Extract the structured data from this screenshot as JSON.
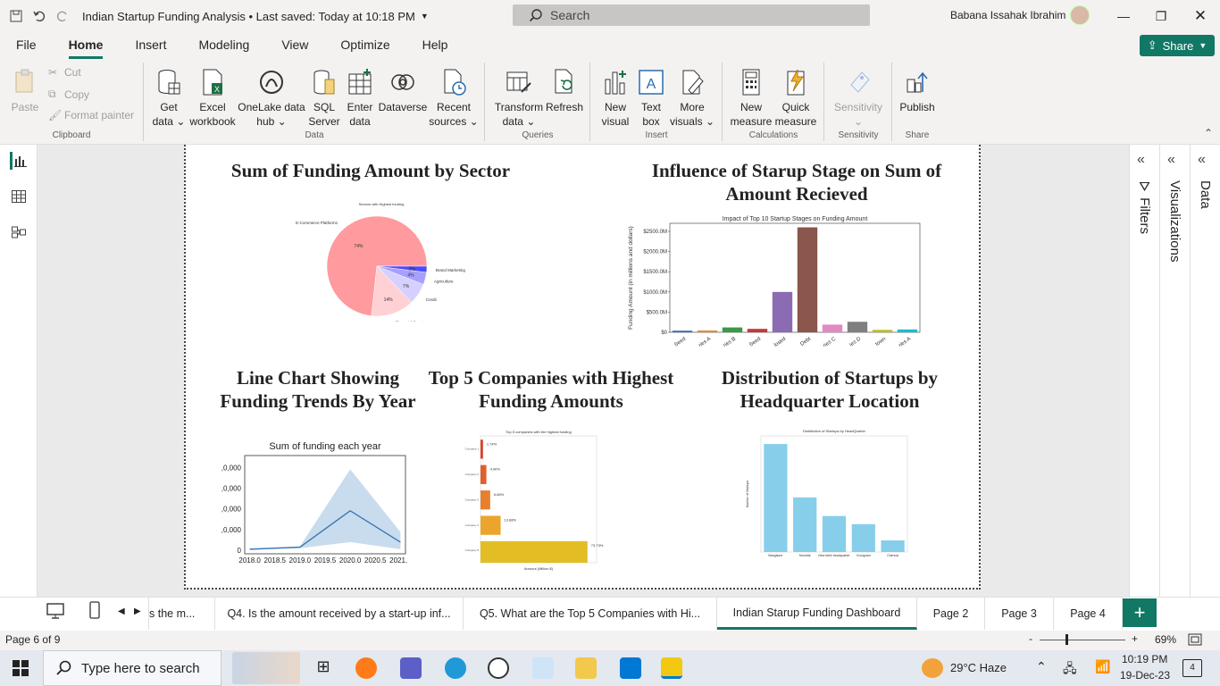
{
  "titlebar": {
    "title": "Indian Startup Funding Analysis • Last saved: Today at 10:18 PM",
    "search_placeholder": "Search",
    "user": "Babana Issahak Ibrahim"
  },
  "menu": [
    "File",
    "Home",
    "Insert",
    "Modeling",
    "View",
    "Optimize",
    "Help"
  ],
  "share_label": "Share",
  "ribbon": {
    "clipboard": {
      "paste": "Paste",
      "cut": "Cut",
      "copy": "Copy",
      "format_painter": "Format painter",
      "group": "Clipboard"
    },
    "data": {
      "get_data": [
        "Get",
        "data ⌄"
      ],
      "excel": [
        "Excel",
        "workbook"
      ],
      "onelake": [
        "OneLake data",
        "hub ⌄"
      ],
      "sql": [
        "SQL",
        "Server"
      ],
      "enter": [
        "Enter",
        "data"
      ],
      "dataverse": [
        "Dataverse",
        ""
      ],
      "recent": [
        "Recent",
        "sources ⌄"
      ],
      "group": "Data"
    },
    "queries": {
      "transform": [
        "Transform",
        "data ⌄"
      ],
      "refresh": [
        "Refresh",
        ""
      ],
      "group": "Queries"
    },
    "insert": {
      "new_visual": [
        "New",
        "visual"
      ],
      "text_box": [
        "Text",
        "box"
      ],
      "more_visuals": [
        "More",
        "visuals ⌄"
      ],
      "group": "Insert"
    },
    "calculations": {
      "new_measure": [
        "New",
        "measure"
      ],
      "quick_measure": [
        "Quick",
        "measure"
      ],
      "group": "Calculations"
    },
    "sensitivity": {
      "label": [
        "Sensitivity",
        "⌄"
      ],
      "group": "Sensitivity"
    },
    "share": {
      "publish": [
        "Publish",
        ""
      ],
      "group": "Share"
    }
  },
  "visuals": {
    "v1_title": "Sum of Funding Amount by Sector",
    "v2_title": "Influence of Starup Stage on Sum of Amount Recieved",
    "v3_title": "Line Chart Showing Funding Trends By Year",
    "v4_title": "Top 5 Companies with Highest Funding Amounts",
    "v5_title": "Distribution of Startups by Headquarter Location"
  },
  "chart_data": [
    {
      "type": "pie",
      "title": "Sectors with Highest funding",
      "categories": [
        "E-Commerce Platforms",
        "Financial Services",
        "Credit",
        "Agriculture",
        "Brand Marketing"
      ],
      "values": [
        74,
        14,
        7,
        4,
        2
      ],
      "labels": [
        "74%",
        "14%",
        "7%",
        "4%",
        "2%"
      ],
      "colors": [
        "#ff9a9e",
        "#ffd0d4",
        "#d6d0ff",
        "#a8a0ff",
        "#4a4aff"
      ]
    },
    {
      "type": "bar",
      "title": "Impact of Top 10 Startup Stages on Funding Amount",
      "ylabel": "Funding Amount (in millions and dollars)",
      "categories": [
        "Seed",
        "Series A",
        "Series B",
        "Seed",
        "Undisclosed",
        "Debt",
        "Series C",
        "Series D",
        "Unknown",
        "Pre-series A"
      ],
      "tick_labels": [
        "Seed",
        "ries A",
        "ries B",
        "Seed",
        "losed",
        "Debt",
        "ries C",
        "ies D",
        "town",
        "ries A"
      ],
      "values": [
        40,
        45,
        120,
        85,
        1000,
        2600,
        190,
        260,
        60,
        70
      ],
      "yticks": [
        "$0",
        "$500.0M",
        "$1000.0M",
        "$1500.0M",
        "$2000.0M",
        "$2500.0M"
      ],
      "ylim": [
        0,
        2700
      ],
      "colors": [
        "#3b6fb6",
        "#e08b3c",
        "#3a9a46",
        "#c33a3a",
        "#8c6bb5",
        "#8b564b",
        "#e08ac2",
        "#7f7f7f",
        "#bcbd22",
        "#17becf"
      ]
    },
    {
      "type": "line",
      "title": "Sum of funding each year",
      "x": [
        2018,
        2019,
        2020,
        2021
      ],
      "values": [
        0.5,
        1.5,
        19.5,
        4
      ],
      "ci_low": [
        0.5,
        1,
        4,
        0.5
      ],
      "ci_high": [
        0.5,
        2,
        40,
        9
      ],
      "xticks": [
        "2018.0",
        "2018.5",
        "2019.0",
        "2019.5",
        "2020.0",
        "2020.5",
        "2021.0"
      ],
      "yticks": [
        "0",
        ",0,000",
        ",0,000",
        ",0,000",
        ",0,000"
      ],
      "ylim": [
        0,
        45
      ]
    },
    {
      "type": "bar",
      "orientation": "horizontal",
      "title": "Top 5 companies with the highest funding",
      "xlabel": "Amount (Million $)",
      "categories": [
        "Company 1",
        "Company 2",
        "Company 3",
        "Company 4",
        "Company 5"
      ],
      "values": [
        1.74,
        4.06,
        6.68,
        13.88,
        73.73
      ],
      "labels": [
        "1.74%",
        "4.06%",
        "6.68%",
        "13.88%",
        "73.73%"
      ],
      "colors": [
        "#d9442a",
        "#e0602c",
        "#e6802e",
        "#eba52c",
        "#e3bd24"
      ]
    },
    {
      "type": "bar",
      "title": "Distribution of Startups by HeadQuarter",
      "ylabel": "Number of Startups",
      "categories": [
        "Bangalore",
        "Mumbai",
        "New Delhi Headquarter",
        "Gurugram",
        "Chennai"
      ],
      "tick_labels": [
        "Bangalore",
        "Mumbai",
        "New delhi headquarter",
        "Gurugram",
        "Chennai"
      ],
      "values": [
        930,
        470,
        310,
        240,
        100
      ],
      "ylim": [
        0,
        1000
      ],
      "color": "#87ceeb"
    }
  ],
  "pane_labels": {
    "filters": "Filters",
    "visualizations": "Visualizations",
    "data": "Data"
  },
  "tabs": [
    "s the m...",
    "Q4. Is the amount received by a start-up inf...",
    "Q5. What are the Top 5 Companies with Hi...",
    "Indian Starup Funding Dashboard",
    "Page 2",
    "Page 3",
    "Page 4"
  ],
  "status": {
    "page": "Page 6 of 9",
    "zoom": "69%"
  },
  "taskbar": {
    "search": "Type here to search",
    "weather": "29°C  Haze",
    "time": "10:19 PM",
    "date": "19-Dec-23",
    "notifications": "4"
  }
}
